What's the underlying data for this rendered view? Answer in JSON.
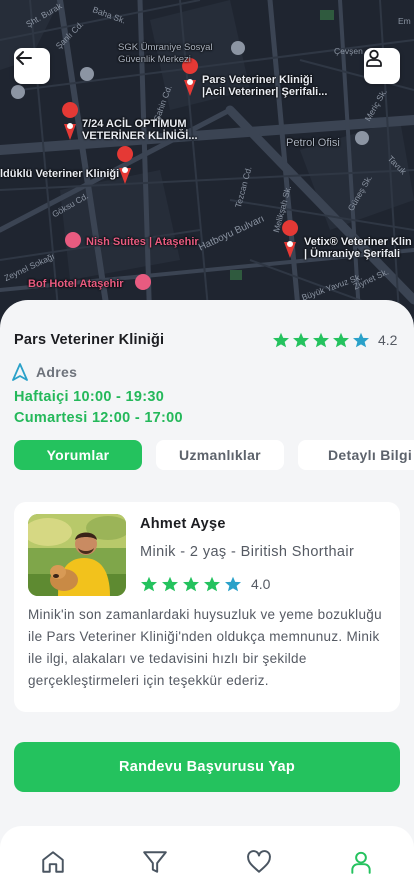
{
  "map": {
    "labels": {
      "pars": "Pars Veteriner Kliniği\n|Acil Veteriner| Şerifali...",
      "acil": "7/24 ACİL OPTİMUM\nVETERİNER KLİNİĞİ...",
      "ulduklu": "ldüklü Veteriner Kliniği",
      "nish": "Nish Suites | Ataşehir",
      "bof": "Bof Hotel Ataşehir",
      "vetix": "Vetix® Veteriner Klin\n| Ümraniye Şerifali",
      "sgk": "SGK Ümraniye Sosyal\nGüvenlik Merkezi",
      "petrol": "Petrol Ofisi"
    },
    "streets": {
      "s1": "Şht. Burak",
      "s2": "Şanlı Cd.",
      "s3": "Baha Sk.",
      "s4": "Çevşen",
      "s5": "Şahin Cd.",
      "s6": "Tezcan Cd.",
      "s7": "Hatboyu Bulvarı",
      "s8": "Göksu Cd.",
      "s9": "Meriç Sk.",
      "s10": "Ziynet Sk.",
      "s11": "Büyük Yavuz Sk.",
      "s12": "Tavuk",
      "s13": "Em",
      "s14": "Melikşah Sk.",
      "s15": "Zeynel Sokağı",
      "s16": "Güneş Sk."
    }
  },
  "clinic": {
    "name": "Pars Veteriner Kliniği",
    "rating": "4.2",
    "address_label": "Adres",
    "hours_weekday": "Haftaiçi 10:00 - 19:30",
    "hours_saturday": "Cumartesi 12:00 - 17:00"
  },
  "tabs": [
    "Yorumlar",
    "Uzmanlıklar",
    "Detaylı Bilgi"
  ],
  "review": {
    "author": "Ahmet Ayşe",
    "pet": "Minik - 2 yaş  - Biritish Shorthair",
    "rating": "4.0",
    "text": "Minik'in son zamanlardaki huysuzluk ve yeme bozukluğu ile Pars Veteriner Kliniği'nden oldukça memnunuz. Minik ile ilgi, alakaları ve tedavisini hızlı bir şekilde gerçekleştirmeleri için teşekkür ederiz."
  },
  "cta_label": "Randevu Başvurusu Yap",
  "colors": {
    "accent": "#24c25e",
    "star_green": "#24c25e",
    "star_teal": "#2aa1c9",
    "map_bg": "#1f2530",
    "pin_red": "#e53935"
  },
  "icons": {
    "back": "arrow-left-icon",
    "profile": "user-icon",
    "nav": [
      "home-icon",
      "filter-icon",
      "heart-icon",
      "user-icon"
    ]
  }
}
